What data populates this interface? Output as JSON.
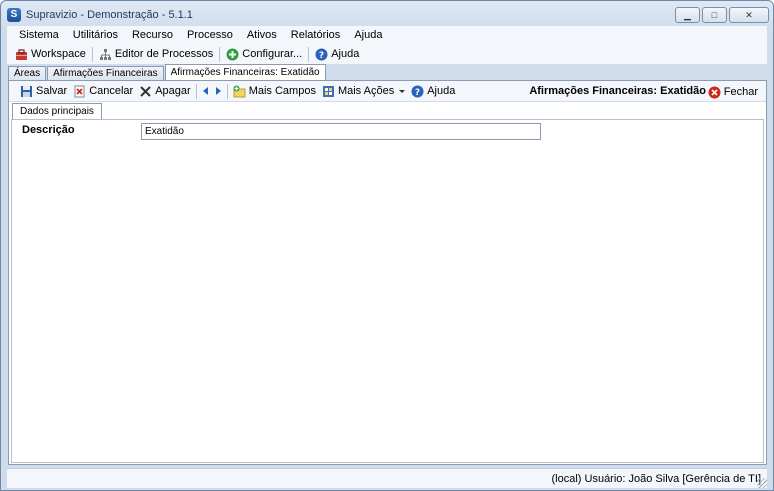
{
  "window": {
    "title": "Supravizio - Demonstração - 5.1.1",
    "app_icon_glyph": "S",
    "controls": {
      "minimize": "▁",
      "maximize": "□",
      "close": "✕"
    }
  },
  "menu": [
    "Sistema",
    "Utilitários",
    "Recurso",
    "Processo",
    "Ativos",
    "Relatórios",
    "Ajuda"
  ],
  "main_toolbar": {
    "workspace": "Workspace",
    "process_editor": "Editor de Processos",
    "configure": "Configurar...",
    "help": "Ajuda"
  },
  "doc_tabs": [
    "Áreas",
    "Afirmações Financeiras",
    "Afirmações Financeiras: Exatidão"
  ],
  "actions": {
    "save": "Salvar",
    "cancel": "Cancelar",
    "delete": "Apagar",
    "more_fields": "Mais Campos",
    "more_actions": "Mais Ações",
    "help": "Ajuda",
    "record_title": "Afirmações Financeiras: Exatidão",
    "close": "Fechar"
  },
  "inner_tabs": [
    "Dados principais"
  ],
  "form": {
    "description_label": "Descrição",
    "description_value": "Exatidão"
  },
  "status": "(local)  Usuário: João Silva [Gerência de TI]",
  "colors": {
    "accent_blue": "#2a62b8",
    "frame_border": "#8a9bb2",
    "toolbar_bg": "#f3f6fb"
  }
}
